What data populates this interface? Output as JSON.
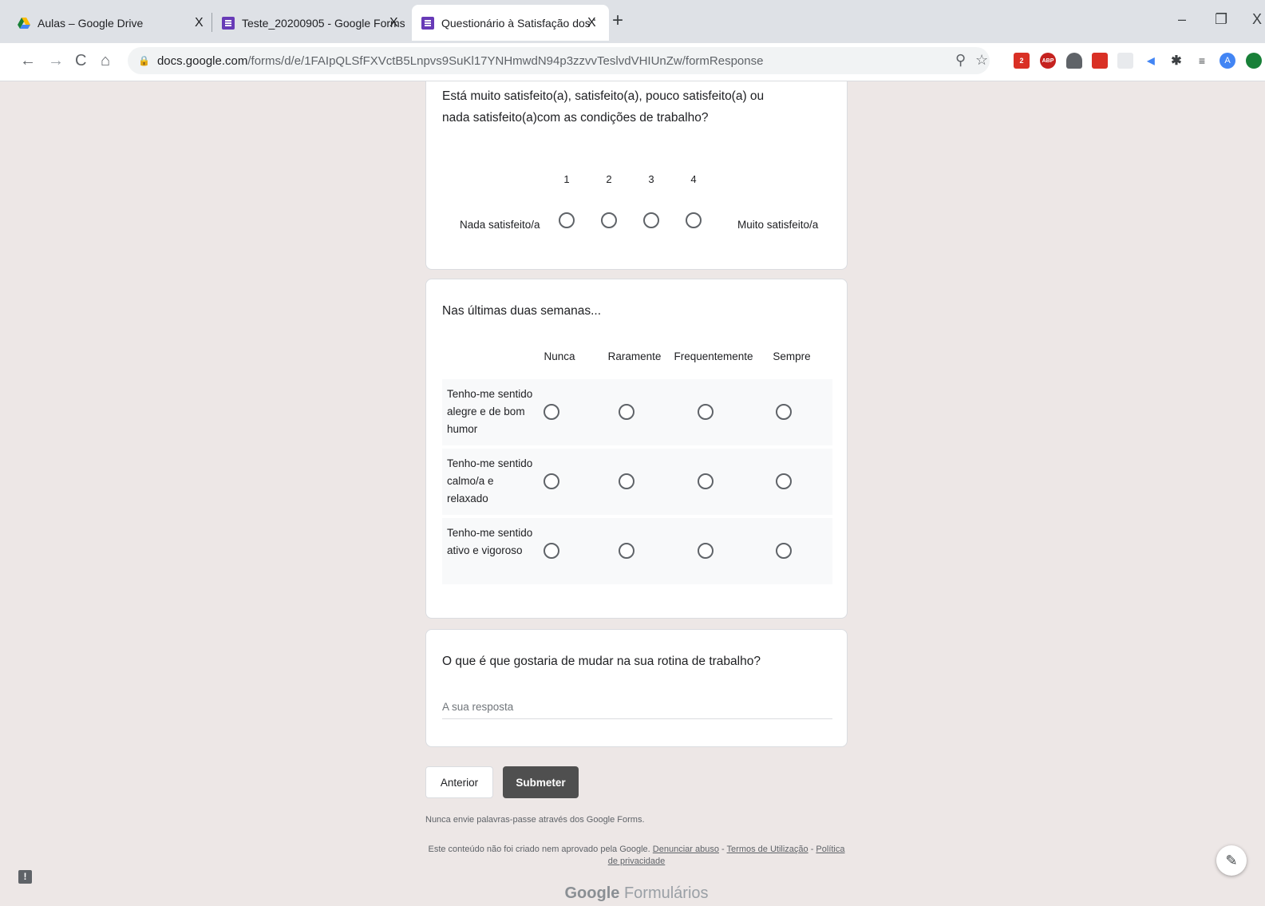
{
  "browser": {
    "tabs": [
      {
        "title": "Aulas – Google Drive",
        "close": "X"
      },
      {
        "title": "Teste_20200905 - Google Forms",
        "close": "X"
      },
      {
        "title": "Questionário à Satisfação dos Tra",
        "close": "X"
      }
    ],
    "new_tab": "+",
    "window_controls": {
      "minimize": "–",
      "restore": "❐",
      "close": "X"
    },
    "nav": {
      "back": "←",
      "forward": "→",
      "reload": "C",
      "home": "⌂"
    },
    "url_host": "docs.google.com",
    "url_path": "/forms/d/e/1FAIpQLSfFXVctB5Lnpvs9SuKl17YNHmwdN94p3zzvvTeslvdVHIUnZw/formResponse",
    "extensions": {
      "badge": "2",
      "abp": "ABP",
      "profile": "A"
    }
  },
  "form": {
    "q1": {
      "title": "Está muito satisfeito(a), satisfeito(a), pouco satisfeito(a) ou nada satisfeito(a)com as condições de trabalho?",
      "scale": [
        "1",
        "2",
        "3",
        "4"
      ],
      "low_label": "Nada satisfeito/a",
      "high_label": "Muito satisfeito/a"
    },
    "q2": {
      "title": "Nas últimas duas semanas...",
      "columns": [
        "Nunca",
        "Raramente",
        "Frequentemente",
        "Sempre"
      ],
      "rows": [
        "Tenho-me sentido alegre e de bom humor",
        "Tenho-me sentido calmo/a e relaxado",
        "Tenho-me sentido ativo e vigoroso"
      ]
    },
    "q3": {
      "title": "O que é que gostaria de mudar na sua rotina de trabalho?",
      "placeholder": "A sua resposta"
    },
    "buttons": {
      "back": "Anterior",
      "submit": "Submeter"
    },
    "note": "Nunca envie palavras-passe através dos Google Forms.",
    "disclaimer": {
      "text": "Este conteúdo não foi criado nem aprovado pela Google.",
      "report": "Denunciar abuso",
      "sep1": " - ",
      "terms": "Termos de Utilização",
      "sep2": " - ",
      "privacy": "Política de privacidade"
    },
    "brand_google": "Google",
    "brand_product": "Formulários"
  }
}
